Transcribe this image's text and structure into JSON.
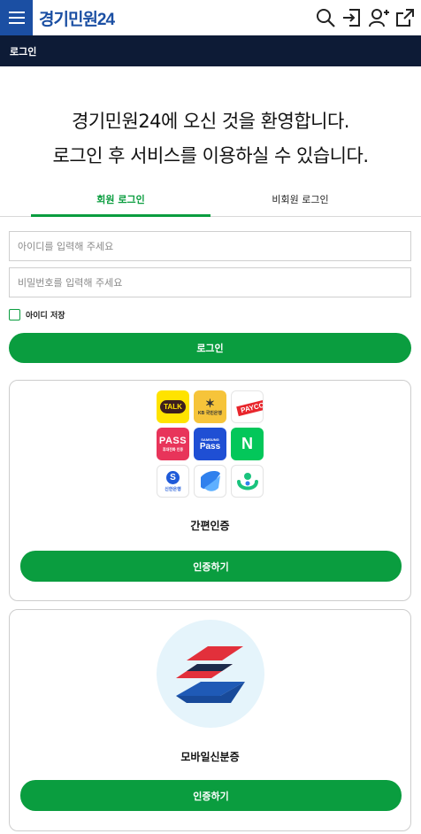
{
  "header": {
    "logo": "경기민원24",
    "icons": [
      "menu-icon",
      "search-icon",
      "login-icon",
      "user-add-icon",
      "share-icon"
    ]
  },
  "breadcrumb": {
    "label": "로그인"
  },
  "welcome": {
    "line1": "경기민원24에 오신 것을 환영합니다.",
    "line2": "로그인 후 서비스를 이용하실 수 있습니다."
  },
  "tabs": {
    "member": "회원 로그인",
    "guest": "비회원 로그인",
    "active": "member"
  },
  "form": {
    "id_placeholder": "아이디를 입력해 주세요",
    "pw_placeholder": "비밀번호를 입력해 주세요",
    "save_id_label": "아이디 저장",
    "save_id_checked": false,
    "login_button": "로그인"
  },
  "easy_auth": {
    "providers": {
      "kakao": "TALK",
      "kb": "KB 국민은행",
      "payco": "PAYCO",
      "pass": "PASS",
      "pass_sub": "휴대전화 인증",
      "samsung_sub": "SAMSUNG",
      "samsung": "Pass",
      "naver": "N",
      "shinhan_mark": "S",
      "shinhan": "신한은행"
    },
    "title": "간편인증",
    "button": "인증하기"
  },
  "mobile_id": {
    "title": "모바일신분증",
    "button": "인증하기"
  },
  "colors": {
    "primary_green": "#0a9d3f",
    "brand_blue": "#1b4fa3",
    "nav_dark": "#0d1b36"
  }
}
